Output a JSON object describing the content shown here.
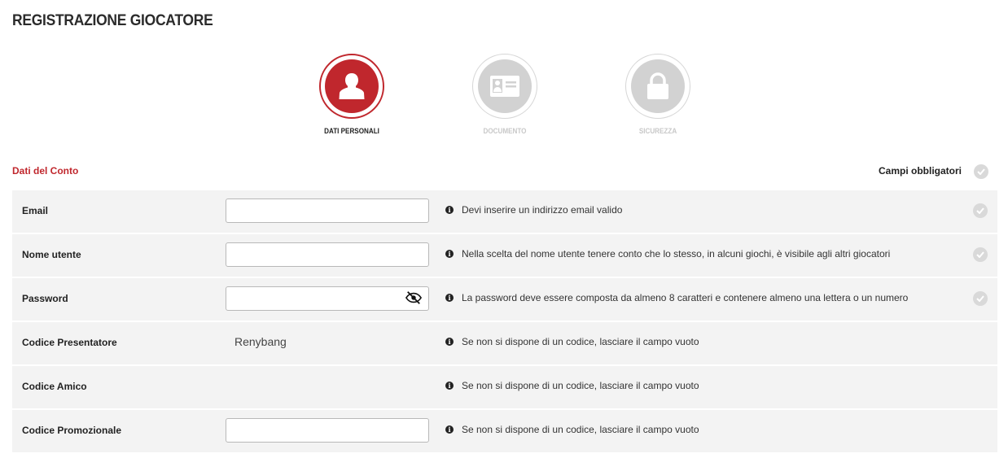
{
  "page": {
    "title": "REGISTRAZIONE GIOCATORE"
  },
  "steps": [
    {
      "label": "DATI PERSONALI",
      "icon": "user-icon",
      "active": true
    },
    {
      "label": "DOCUMENTO",
      "icon": "id-card-icon",
      "active": false
    },
    {
      "label": "SICUREZZA",
      "icon": "lock-icon",
      "active": false
    }
  ],
  "section": {
    "title": "Dati del Conto",
    "required_note": "Campi obbligatori"
  },
  "form": {
    "rows": [
      {
        "label": "Email",
        "value": "",
        "hint": "Devi inserire un indirizzo email valido",
        "required": true
      },
      {
        "label": "Nome utente",
        "value": "",
        "hint": "Nella scelta del nome utente tenere conto che lo stesso, in alcuni giochi, è visibile agli altri giocatori",
        "required": true
      },
      {
        "label": "Password",
        "value": "",
        "hint": "La password deve essere composta da almeno 8 caratteri e contenere almeno una lettera o un numero",
        "required": true
      },
      {
        "label": "Codice Presentatore",
        "value": "Renybang",
        "hint": "Se non si dispone di un codice, lasciare il campo vuoto",
        "required": false
      },
      {
        "label": "Codice Amico",
        "value": "",
        "hint": "Se non si dispone di un codice, lasciare il campo vuoto",
        "required": false
      },
      {
        "label": "Codice Promozionale",
        "value": "",
        "hint": "Se non si dispone di un codice, lasciare il campo vuoto",
        "required": false
      }
    ]
  },
  "colors": {
    "accent": "#c0272d",
    "inactive": "#d2d2d2",
    "row_bg": "#f3f3f3"
  }
}
